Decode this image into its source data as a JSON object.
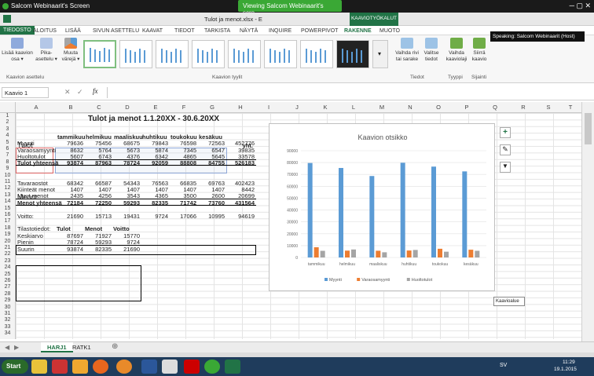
{
  "window": {
    "title": "Salcom Webinaarit's Screen",
    "file_title": "Tulot ja menot.xlsx - E",
    "viewing": "Viewing Salcom Webinaarit's scre...",
    "tool_context": "KAAVIOTYÖKALUT",
    "speaking": "Speaking: Salcom Webinaarit (Host)"
  },
  "ribbon": {
    "tabs": [
      "TIEDOSTO",
      "ALOITUS",
      "LISÄÄ",
      "SIVUN ASETTELU",
      "KAAVAT",
      "TIEDOT",
      "TARKISTA",
      "NÄYTÄ",
      "INQUIRE",
      "POWERPIVOT",
      "RAKENNE",
      "MUOTO"
    ],
    "buttons": {
      "add_element": "Lisää kaavion osa ▾",
      "quick_layout": "Pika-asettelu ▾",
      "change_colors": "Muuta värejä ▾",
      "switch_row_col": "Vaihda rivi tai sarake",
      "select_data": "Valitse tiedot",
      "change_type": "Vaihda kaaviolaji",
      "move_chart": "Siirrä kaavio"
    },
    "groups": {
      "layouts": "Kaavion asettelu",
      "styles": "Kaavion tyylit",
      "data": "Tiedot",
      "type": "Tyyppi",
      "location": "Sijainti"
    }
  },
  "formula": {
    "name_box": "Kaavio 1",
    "fx": "fx",
    "value": ""
  },
  "columns": [
    "A",
    "B",
    "C",
    "D",
    "E",
    "F",
    "G",
    "H",
    "I",
    "J",
    "K",
    "L",
    "M",
    "N",
    "O",
    "P",
    "Q",
    "R",
    "S",
    "T"
  ],
  "rows": [
    "1",
    "2",
    "3",
    "4",
    "5",
    "6",
    "7",
    "8",
    "9",
    "10",
    "11",
    "12",
    "13",
    "14",
    "15",
    "16",
    "17",
    "18",
    "19",
    "20",
    "21",
    "22",
    "23",
    "24",
    "25",
    "26",
    "27",
    "28",
    "29",
    "30",
    "31",
    "32",
    "33",
    "34"
  ],
  "sheet": {
    "title": "Tulot ja menot 1.1.20XX - 30.6.20XX",
    "tulot_header": "Tulot",
    "yht": "yht.",
    "months": [
      "tammikuu",
      "helmikuu",
      "maaliskuu",
      "huhtikuu",
      "toukokuu",
      "kesäkuu"
    ],
    "income_rows": [
      {
        "label": "Myynti",
        "values": [
          "79636",
          "75456",
          "68675",
          "79843",
          "76598",
          "72563"
        ],
        "total": "452776"
      },
      {
        "label": "Varaosamyynti",
        "values": [
          "8632",
          "5764",
          "5673",
          "5874",
          "7345",
          "6547"
        ],
        "total": "39835"
      },
      {
        "label": "Huoltotulot",
        "values": [
          "5607",
          "6743",
          "4376",
          "6342",
          "4865",
          "5645"
        ],
        "total": "33578"
      }
    ],
    "income_total": {
      "label": "Tulot yhteensä",
      "values": [
        "93874",
        "87963",
        "78724",
        "92059",
        "88808",
        "84755"
      ],
      "total": "526183"
    },
    "menot_header": "Menot",
    "expense_rows": [
      {
        "label": "Tavaraostot",
        "values": [
          "68342",
          "66587",
          "54343",
          "76563",
          "66835",
          "69763"
        ],
        "total": "402423"
      },
      {
        "label": "Kiinteät menot",
        "values": [
          "1407",
          "1407",
          "1407",
          "1407",
          "1407",
          "1407"
        ],
        "total": "8442"
      },
      {
        "label": "Muut menot",
        "values": [
          "2435",
          "4256",
          "3543",
          "4365",
          "3500",
          "2600"
        ],
        "total": "20699"
      }
    ],
    "expense_total": {
      "label": "Menot yhteensä",
      "values": [
        "72184",
        "72250",
        "59293",
        "82335",
        "71742",
        "73760"
      ],
      "total": "431564"
    },
    "voitto": {
      "label": "Voitto:",
      "values": [
        "21690",
        "15713",
        "19431",
        "9724",
        "17066",
        "10995"
      ],
      "total": "94619"
    },
    "stats": {
      "label": "Tilastotiedot:",
      "headers": [
        "Tulot",
        "Menot",
        "Voitto"
      ],
      "rows": [
        {
          "label": "Keskiarvo",
          "values": [
            "87697",
            "71927",
            "15770"
          ]
        },
        {
          "label": "Pienin",
          "values": [
            "78724",
            "59293",
            "9724"
          ]
        },
        {
          "label": "Suurin",
          "values": [
            "93874",
            "82335",
            "21690"
          ]
        }
      ]
    }
  },
  "chart_data": {
    "type": "bar",
    "title": "Kaavion otsikko",
    "categories": [
      "tammikuu",
      "helmikuu",
      "maaliskuu",
      "huhtikuu",
      "toukokuu",
      "kesäkuu"
    ],
    "series": [
      {
        "name": "Myynti",
        "values": [
          79636,
          75456,
          68675,
          79843,
          76598,
          72563
        ],
        "color": "#5b9bd5"
      },
      {
        "name": "Varaosamyynti",
        "values": [
          8632,
          5764,
          5673,
          5874,
          7345,
          6547
        ],
        "color": "#ed7d31"
      },
      {
        "name": "Huoltotulot",
        "values": [
          5607,
          6743,
          4376,
          6342,
          4865,
          5645
        ],
        "color": "#a5a5a5"
      }
    ],
    "ylim": [
      0,
      90000
    ],
    "yticks": [
      "0",
      "10000",
      "20000",
      "30000",
      "40000",
      "50000",
      "60000",
      "70000",
      "80000",
      "90000"
    ],
    "legend": "bottom",
    "grid": true
  },
  "chart_tooltip": "Kaavioalue",
  "sheet_tabs": [
    "HARJ1",
    "RATK1"
  ],
  "taskbar": {
    "start": "Start",
    "lang": "SV",
    "time": "11:29",
    "date": "19.1.2015"
  }
}
